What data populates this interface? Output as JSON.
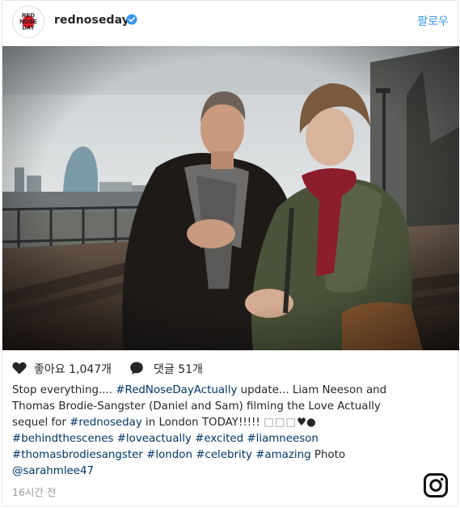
{
  "post": {
    "username": "rednoseday",
    "follow_label": "팔로우",
    "avatar_text": [
      "RED",
      "NOSE",
      "DAY"
    ],
    "likes_text": "좋아요 1,047개",
    "comments_text": "댓글 51개",
    "caption": {
      "l1_a": "Stop everything.... ",
      "l1_tag": "#RedNoseDayActually",
      "l1_b": " update... Liam Neeson and",
      "l2": "Thomas Brodie-Sangster (Daniel and Sam) filming the Love Actually",
      "l3_a": "sequel for ",
      "l3_tag": "#rednoseday",
      "l3_b": " in London TODAY!!!!! ",
      "l3_boxes": "□□□",
      "l3_c": "♥●",
      "l4_t1": "#behindthescenes",
      "l4_t2": "#loveactually",
      "l4_t3": "#excited",
      "l4_t4": "#liamneeson",
      "l5_t1": "#thomasbrodiesangster",
      "l5_t2": "#london",
      "l5_t3": "#celebrity",
      "l5_t4": "#amazing",
      "l5_b": " Photo",
      "l6_mention": "@sarahmlee47"
    },
    "timestamp": "16시간 전"
  },
  "icons": {
    "verified": "verified-badge-icon",
    "like": "heart-icon",
    "comment": "comment-bubble-icon",
    "logo": "instagram-logo-icon"
  },
  "colors": {
    "link": "#003569",
    "follow": "#3897f0",
    "verified": "#3897f0",
    "muted": "#999999",
    "brand_red": "#e5202e"
  }
}
